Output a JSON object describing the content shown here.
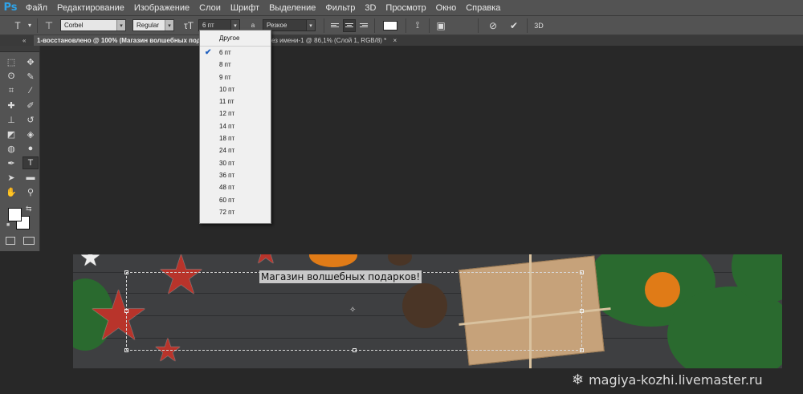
{
  "app": {
    "logo": "Ps"
  },
  "menubar": {
    "items": [
      "Файл",
      "Редактирование",
      "Изображение",
      "Слои",
      "Шрифт",
      "Выделение",
      "Фильтр",
      "3D",
      "Просмотр",
      "Окно",
      "Справка"
    ]
  },
  "options": {
    "font_family": "Corbel",
    "font_style": "Regular",
    "font_size": "6 пт",
    "aa_label": "а",
    "antialias": "Резкое",
    "text_color": "#ffffff",
    "threed_label": "3D"
  },
  "tabs": {
    "collapse": "«",
    "doc1": "1-восстановлено @ 100% (Магазин волшебных под",
    "doc1_close": "×",
    "doc2": "ез имени-1 @ 86,1% (Слой 1, RGB/8) *",
    "doc2_close": "×"
  },
  "size_dropdown": {
    "header": "Другое",
    "items": [
      "6 пт",
      "8 пт",
      "9 пт",
      "10 пт",
      "11 пт",
      "12 пт",
      "14 пт",
      "18 пт",
      "24 пт",
      "30 пт",
      "36 пт",
      "48 пт",
      "60 пт",
      "72 пт"
    ],
    "selected_index": 0
  },
  "canvas": {
    "banner_text": "Магазин волшебных подарков!"
  },
  "watermark": {
    "text": "magiya-kozhi.livemaster.ru"
  },
  "colors": {
    "foreground": "#ffffff",
    "background": "#ffffff",
    "accent": "#2fa3e7"
  }
}
